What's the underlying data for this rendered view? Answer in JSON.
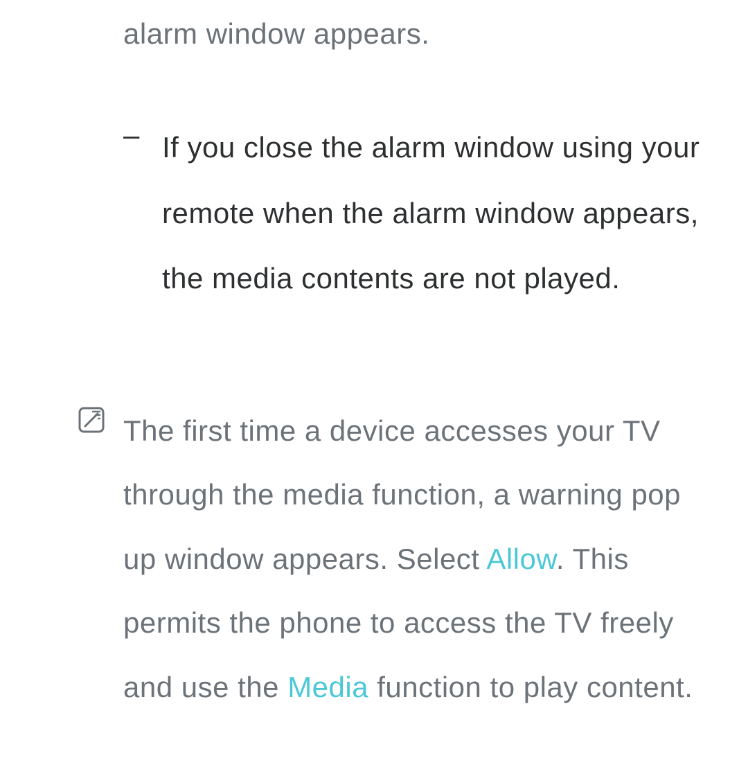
{
  "fragment_top": "alarm window appears.",
  "sub_item": {
    "dash": "–",
    "text": "If you close the alarm window using your remote when the alarm window appears, the media contents are not played."
  },
  "note": {
    "icon_name": "note-icon",
    "part1": "The first time a device accesses your TV through the media function, a warning pop up window appears. Select ",
    "allow": "Allow",
    "part2": ". This permits the phone to access the TV freely and use the ",
    "media": "Media",
    "part3": " function to play content."
  }
}
